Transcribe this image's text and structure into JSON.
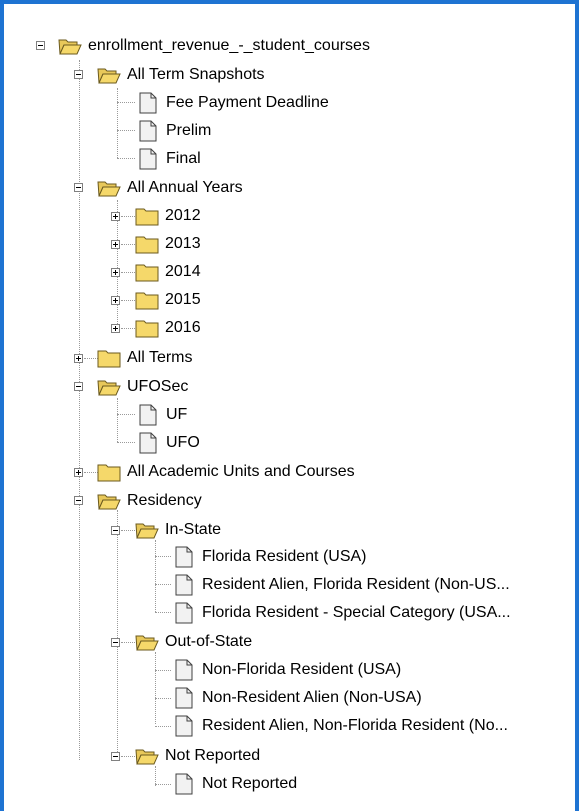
{
  "tree": {
    "root": {
      "label": "enrollment_revenue_-_student_courses",
      "icon": "folder-open-icon"
    },
    "term_snapshots": {
      "label": "All Term Snapshots",
      "icon": "folder-open-icon",
      "items": [
        "Fee Payment Deadline",
        "Prelim",
        "Final"
      ]
    },
    "annual_years": {
      "label": "All Annual Years",
      "icon": "folder-open-icon",
      "items": [
        "2012",
        "2013",
        "2014",
        "2015",
        "2016"
      ]
    },
    "all_terms": {
      "label": "All Terms",
      "icon": "folder-icon"
    },
    "ufosec": {
      "label": "UFOSec",
      "icon": "folder-open-icon",
      "items": [
        "UF",
        "UFO"
      ]
    },
    "academic_units": {
      "label": "All Academic Units and Courses",
      "icon": "folder-icon"
    },
    "residency": {
      "label": "Residency",
      "icon": "folder-open-icon",
      "in_state": {
        "label": "In-State",
        "items": [
          "Florida Resident (USA)",
          "Resident Alien, Florida Resident (Non-US...",
          "Florida Resident - Special Category (USA..."
        ]
      },
      "out_of_state": {
        "label": "Out-of-State",
        "items": [
          "Non-Florida Resident (USA)",
          "Non-Resident Alien (Non-USA)",
          "Resident Alien, Non-Florida Resident (No..."
        ]
      },
      "not_reported": {
        "label": "Not Reported",
        "items": [
          "Not Reported"
        ]
      }
    }
  },
  "colors": {
    "frame_border": "#1e73d2",
    "folder_fill": "#f5d86a",
    "folder_edge": "#6b5a1e",
    "doc_fill": "#f2f2f2",
    "doc_edge": "#404040"
  }
}
